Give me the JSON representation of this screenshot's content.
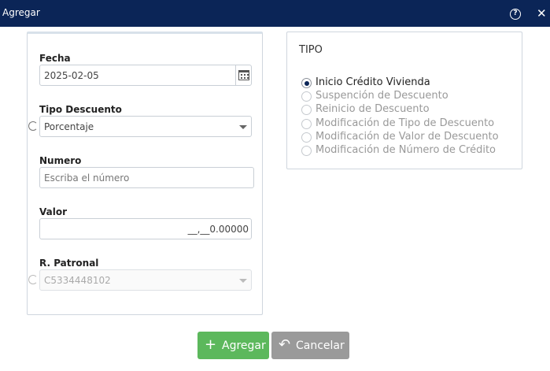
{
  "dialog": {
    "title": "Agregar",
    "help_icon": "help-circle-icon",
    "close_icon": "close-icon",
    "close_glyph": "✕",
    "help_glyph": "?"
  },
  "form": {
    "fecha": {
      "label": "Fecha",
      "value": "2025-02-05"
    },
    "tipo_descuento": {
      "label": "Tipo Descuento",
      "value": "Porcentaje"
    },
    "numero": {
      "label": "Numero",
      "placeholder": "Escriba el número"
    },
    "valor": {
      "label": "Valor",
      "value": "__,__0.00000"
    },
    "r_patronal": {
      "label": "R. Patronal",
      "value": "C5334448102"
    }
  },
  "tipo": {
    "title": "TIPO",
    "options": [
      {
        "label": "Inicio Crédito Vivienda",
        "checked": true
      },
      {
        "label": "Suspención de Descuento",
        "checked": false
      },
      {
        "label": "Reinicio de Descuento",
        "checked": false
      },
      {
        "label": "Modificación de Tipo de Descuento",
        "checked": false
      },
      {
        "label": "Modificación de Valor de Descuento",
        "checked": false
      },
      {
        "label": "Modificación de Número de Crédito",
        "checked": false
      }
    ]
  },
  "buttons": {
    "agregar": {
      "label": "Agregar",
      "icon": "plus-icon",
      "glyph": "+"
    },
    "cancelar": {
      "label": "Cancelar",
      "icon": "undo-icon",
      "glyph": "↶"
    }
  },
  "colors": {
    "titlebar": "#0b2557",
    "primary": "#5cb85c",
    "secondary": "#9a9a9a"
  }
}
